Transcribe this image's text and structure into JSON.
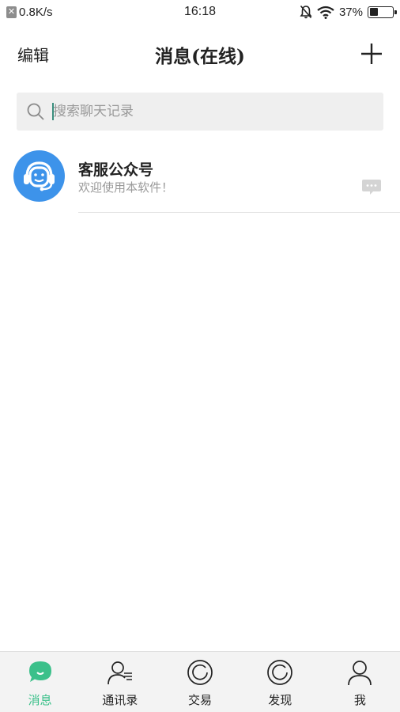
{
  "status_bar": {
    "network_speed": "0.8K/s",
    "time": "16:18",
    "battery_percent": "37%",
    "battery_level": 0.37
  },
  "header": {
    "edit_label": "编辑",
    "title": "消息(在线)",
    "add_icon": "plus-icon"
  },
  "search": {
    "placeholder": "搜索聊天记录",
    "icon": "search-icon"
  },
  "conversations": [
    {
      "name": "客服公众号",
      "preview": "欢迎使用本软件！",
      "avatar_color": "#3d93ea",
      "avatar_icon": "customer-service-headset-icon",
      "status_icon": "chat-bubble-icon"
    }
  ],
  "tab_bar": {
    "active_color": "#3bc08a",
    "tabs": [
      {
        "label": "消息",
        "icon": "message-icon",
        "active": true
      },
      {
        "label": "通讯录",
        "icon": "contacts-icon",
        "active": false
      },
      {
        "label": "交易",
        "icon": "trade-icon",
        "active": false
      },
      {
        "label": "发现",
        "icon": "discover-icon",
        "active": false
      },
      {
        "label": "我",
        "icon": "profile-icon",
        "active": false
      }
    ]
  }
}
